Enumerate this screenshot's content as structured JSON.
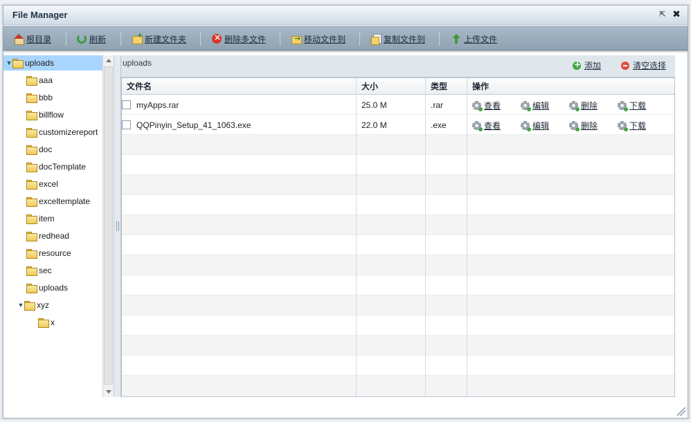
{
  "window": {
    "title": "File Manager"
  },
  "toolbar": {
    "items": [
      {
        "label": "根目录",
        "icon": "home-icon"
      },
      {
        "label": "刷新",
        "icon": "refresh-icon"
      },
      {
        "label": "新建文件夹",
        "icon": "new-folder-icon"
      },
      {
        "label": "删除多文件",
        "icon": "delete-icon"
      },
      {
        "label": "移动文件到",
        "icon": "move-icon"
      },
      {
        "label": "复制文件到",
        "icon": "copy-icon"
      },
      {
        "label": "上传文件",
        "icon": "upload-icon"
      }
    ]
  },
  "tree": {
    "root": "uploads",
    "children": [
      "aaa",
      "bbb",
      "billflow",
      "customizereport",
      "doc",
      "docTemplate",
      "excel",
      "exceltemplate",
      "item",
      "redhead",
      "resource",
      "sec",
      "uploads"
    ],
    "expanded_folder": "xyz",
    "expanded_children": [
      "x"
    ]
  },
  "main": {
    "path": "uploads",
    "add_label": "添加",
    "clear_label": "清空选择",
    "columns": [
      "文件名",
      "大小",
      "类型",
      "操作"
    ],
    "actions": [
      "查看",
      "编辑",
      "删除",
      "下载"
    ],
    "files": [
      {
        "name": "myApps.rar",
        "size": "25.0 M",
        "type": ".rar"
      },
      {
        "name": "QQPinyin_Setup_41_1063.exe",
        "size": "22.0 M",
        "type": ".exe"
      }
    ]
  },
  "colors": {
    "accent": "#a9d6ff",
    "toolbar": "#95a8b8",
    "header": "#dfe6ec"
  }
}
